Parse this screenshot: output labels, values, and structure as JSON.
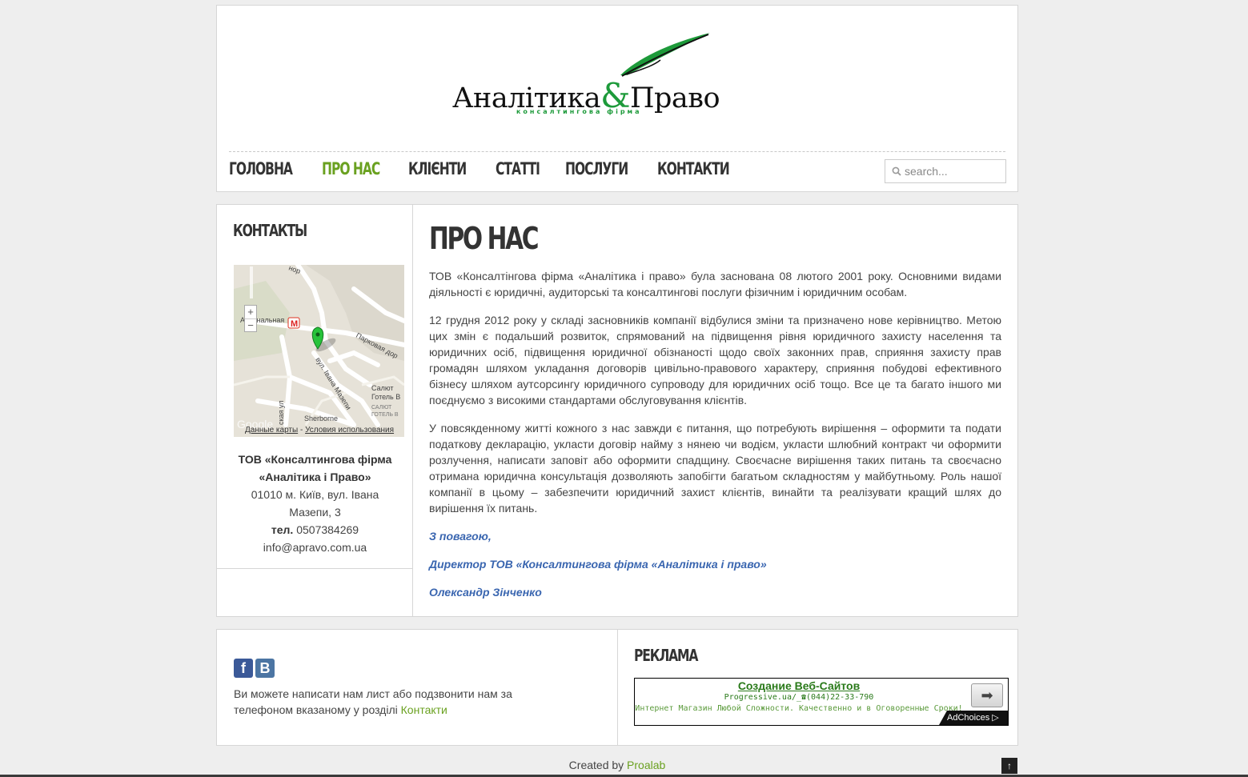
{
  "header": {
    "logo": {
      "word1": "Аналітика",
      "amp": "&",
      "word2": "Право",
      "subtitle": "консалтингова фірма"
    },
    "nav": [
      {
        "label": "ГОЛОВНА",
        "active": false
      },
      {
        "label": "ПРО НАС",
        "active": true
      },
      {
        "label": "КЛІЄНТИ",
        "active": false
      },
      {
        "label": "СТАТТІ",
        "active": false
      },
      {
        "label": "ПОСЛУГИ",
        "active": false
      },
      {
        "label": "КОНТАКТИ",
        "active": false
      }
    ],
    "search": {
      "placeholder": "search..."
    }
  },
  "sidebar": {
    "title": "КОНТАКТЫ",
    "map": {
      "credit_data": "Данные карты",
      "credit_sep": " - ",
      "credit_terms": "Условия использования",
      "labels": [
        "Арсенальная",
        "Парковая дор",
        "вул. Івана Мазепи",
        "Салют",
        "Готель В",
        "САЛЮТ",
        "ГОТЕЛЬ В",
        "Sherborne",
        "ская ул",
        "Google",
        "нор"
      ],
      "metro_symbol": "M"
    },
    "contact": {
      "company_line1": "ТОВ «Консалтингова фірма",
      "company_line2": "«Аналітика і Право»",
      "address_line1": "01010 м. Київ, вул. Івана",
      "address_line2": "Мазепи, 3",
      "phone_label": "тел.",
      "phone": " 0507384269",
      "email": "info@apravo.com.ua"
    }
  },
  "content": {
    "title": "ПРО НАС",
    "paragraphs": [
      "ТОВ «Консалтінгова фірма «Аналітика  і право» була заснована 08 лютого 2001 року. Основними видами діяльності є юридичні, аудиторські та консалтингові послуги фізичним і юридичним особам.",
      "12 грудня 2012 року у складі засновників компанії відбулися зміни та призначено нове керівництво. Метою цих змін є подальший розвиток, спрямований на підвищення рівня юридичного захисту населення та юридичних осіб, підвищення юридичної обізнаності щодо своїх законних прав, сприяння захисту прав громадян шляхом укладання договорів цивільно-правового характеру,  сприяння побудові ефективного бізнесу шляхом аутсорсингу юридичного супроводу для юридичних осіб тощо.  Все це та багато іншого ми поєднуємо з високими стандартами обслуговування клієнтів.",
      "У повсякденному житті кожного з нас завжди є питання, що потребують вирішення – оформити та подати податкову декларацію, укласти договір найму з нянею чи водієм,  укласти шлюбний контракт чи оформити розлучення, написати заповіт або оформити спадщину. Своєчасне вирішення таких питань та своєчасно отримана юридична консультація дозволяють запобігти багатьом складностям у майбутньому. Роль нашої компанії в цьому  – забезпечити юридичний захист клієнтів, винайти та реалізувати кращий шлях до вирішення їх питань."
    ],
    "signature": {
      "regards": "З повагою,",
      "position": "Директор ТОВ «Консалтингова фірма «Аналітика і право»",
      "name": "Олександр Зінченко"
    }
  },
  "footer": {
    "social": {
      "facebook": "f",
      "vkontakte": "B"
    },
    "text": "Ви можете написати нам лист або подзвонити нам за телефоном вказаному у розділі ",
    "link": "Контакти",
    "ad_section_title": "РЕКЛАМА",
    "ad": {
      "headline": "Создание Веб-Сайтов",
      "url": "Progressive.ua/_☎(044)22-33-790",
      "description": "Интернет Магазин Любой Сложности. Качественно и в Оговоренные Сроки!",
      "button": "➡",
      "adchoices": "AdChoices ▷"
    },
    "credit_prefix": "Created by ",
    "credit_link": "Proalab",
    "totop_icon": "↑"
  },
  "colors": {
    "accent_green": "#6aa120",
    "logo_green": "#1d9a3a",
    "signature_blue": "#3a66b0",
    "background": "#eeeeee"
  }
}
